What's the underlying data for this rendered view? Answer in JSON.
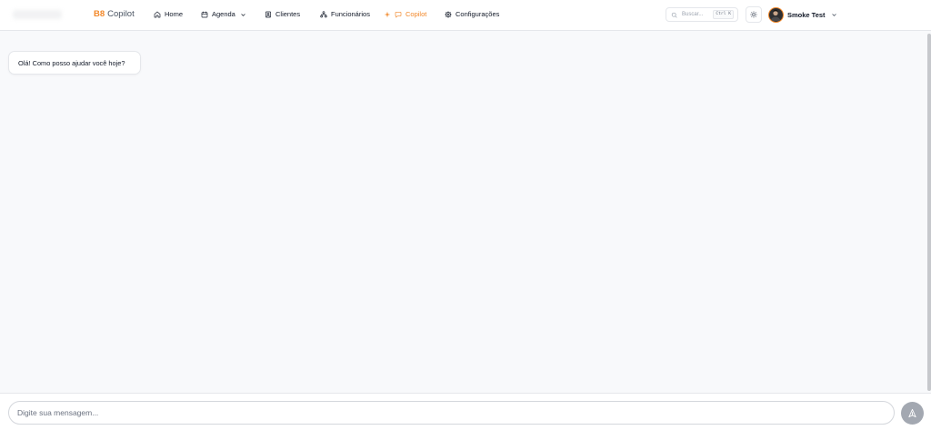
{
  "brand": {
    "mark": "B8",
    "name": "Copilot"
  },
  "nav": {
    "items": [
      {
        "label": "Home",
        "icon": "home-icon"
      },
      {
        "label": "Agenda",
        "icon": "calendar-icon",
        "dropdown": true
      },
      {
        "label": "Clientes",
        "icon": "user-icon"
      },
      {
        "label": "Funcionários",
        "icon": "team-icon"
      },
      {
        "label": "Copilot",
        "icon": "chat-bubble-icon",
        "active": true
      },
      {
        "label": "Configurações",
        "icon": "gear-icon"
      }
    ]
  },
  "search": {
    "placeholder": "Buscar...",
    "shortcut": "Ctrl K",
    "icon": "search-icon"
  },
  "theme_toggle": {
    "icon": "sun-icon"
  },
  "user": {
    "name": "Smoke Test",
    "menu_icon": "chevron-down-icon"
  },
  "chat": {
    "messages": [
      {
        "text": "Olá! Como posso ajudar você hoje?"
      }
    ]
  },
  "composer": {
    "placeholder": "Digite sua mensagem...",
    "send_icon": "send-icon"
  },
  "colors": {
    "accent": "#f2882a",
    "page_background": "#f8f9fb",
    "send_button": "#a3a8b1"
  }
}
